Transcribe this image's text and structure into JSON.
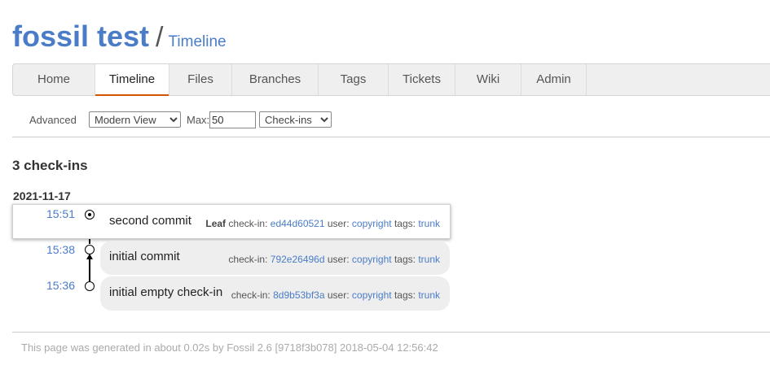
{
  "header": {
    "project_title": "fossil test",
    "separator": "/",
    "page_title": "Timeline"
  },
  "menu": {
    "items": [
      {
        "label": "Home"
      },
      {
        "label": "Timeline",
        "active": true
      },
      {
        "label": "Files"
      },
      {
        "label": "Branches"
      },
      {
        "label": "Tags"
      },
      {
        "label": "Tickets"
      },
      {
        "label": "Wiki"
      },
      {
        "label": "Admin"
      }
    ]
  },
  "submenu": {
    "advanced": "Advanced",
    "view_select": "Modern View",
    "max_label": "Max:",
    "max_value": "50",
    "type_select": "Check-ins"
  },
  "timeline": {
    "count": "3 check-ins",
    "date": "2021-11-17",
    "entries": [
      {
        "time": "15:51",
        "comment": "second commit",
        "leaf": "Leaf",
        "checkin_label": "check-in:",
        "hash": "ed44d60521",
        "user_label": "user:",
        "user": "copyright",
        "tags_label": "tags:",
        "tag": "trunk"
      },
      {
        "time": "15:38",
        "comment": "initial commit",
        "checkin_label": "check-in:",
        "hash": "792e26496d",
        "user_label": "user:",
        "user": "copyright",
        "tags_label": "tags:",
        "tag": "trunk"
      },
      {
        "time": "15:36",
        "comment": "initial empty check-in",
        "checkin_label": "check-in:",
        "hash": "8d9b53bf3a",
        "user_label": "user:",
        "user": "copyright",
        "tags_label": "tags:",
        "tag": "trunk"
      }
    ]
  },
  "footer": {
    "text": "This page was generated in about 0.02s by Fossil 2.6 [9718f3b078] 2018-05-04 12:56:42"
  },
  "colors": {
    "accent": "#4a7cc7",
    "active_tab_underline": "#d35400"
  }
}
